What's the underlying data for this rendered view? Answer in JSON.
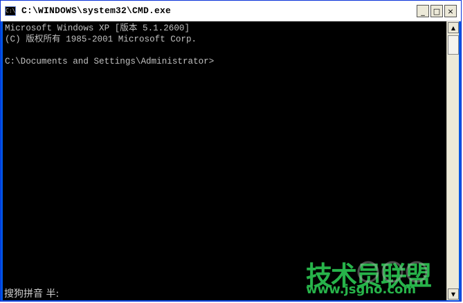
{
  "window": {
    "title": "C:\\WINDOWS\\system32\\CMD.exe",
    "icon": "cmd-icon",
    "buttons": {
      "minimize": "_",
      "maximize": "□",
      "close": "×"
    }
  },
  "console": {
    "lines": [
      "Microsoft Windows XP [版本 5.1.2600]",
      "(C) 版权所有 1985-2001 Microsoft Corp.",
      "",
      "C:\\Documents and Settings\\Administrator>"
    ]
  },
  "ime": {
    "status": "搜狗拼音 半:"
  },
  "watermark": {
    "title": "技术员联盟",
    "url": "www.jsgho.com"
  },
  "colors": {
    "console_bg": "#000000",
    "console_text": "#c0c0c0",
    "watermark": "#27b34a"
  }
}
